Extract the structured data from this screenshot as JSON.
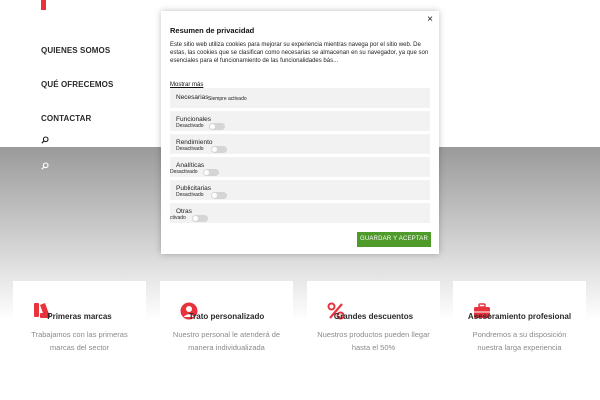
{
  "nav": {
    "items": [
      "QUIENES SOMOS",
      "QUÉ OFRECEMOS",
      "CONTACTAR"
    ]
  },
  "features": [
    {
      "title": "Primeras marcas",
      "desc_line1": "Trabajamos con las primeras",
      "desc_line2": "marcas del sector",
      "icon": "tags-icon"
    },
    {
      "title": "Trato personalizado",
      "desc_line1": "Nuestro personal le atenderá de",
      "desc_line2": "manera individualizada",
      "icon": "user-icon"
    },
    {
      "title": "Grandes descuentos",
      "desc_line1": "Nuestros productos pueden llegar",
      "desc_line2": "hasta el 50%",
      "icon": "percent-icon"
    },
    {
      "title": "Asesoramiento profesional",
      "desc_line1": "Pondremos a su disposición",
      "desc_line2": "nuestra larga experiencia",
      "icon": "briefcase-icon"
    }
  ],
  "colors": {
    "accent_red": "#e8323c",
    "save_green": "#4e9a2b"
  },
  "modal": {
    "title": "Resumen de privacidad",
    "close": "×",
    "body": "Este sitio web utiliza cookies para mejorar su experiencia mientras navega por el sitio web. De estas, las cookies que se clasifican como necesarias se almacenan en su navegador, ya que son esenciales para el funcionamiento de las funcionalidades bás...",
    "show_more": "Mostrar más",
    "categories": [
      {
        "name": "Necesarias",
        "status": "Siempre activado"
      },
      {
        "name": "Funcionales",
        "status": "Desactivado"
      },
      {
        "name": "Rendimiento",
        "status": "Desactivado"
      },
      {
        "name": "Analíticas",
        "status": "Desactivado"
      },
      {
        "name": "Publicitarias",
        "status": "Desactivado"
      },
      {
        "name": "Otras",
        "status": "ctivado"
      }
    ],
    "save_label": "GUARDAR Y ACEPTAR"
  }
}
